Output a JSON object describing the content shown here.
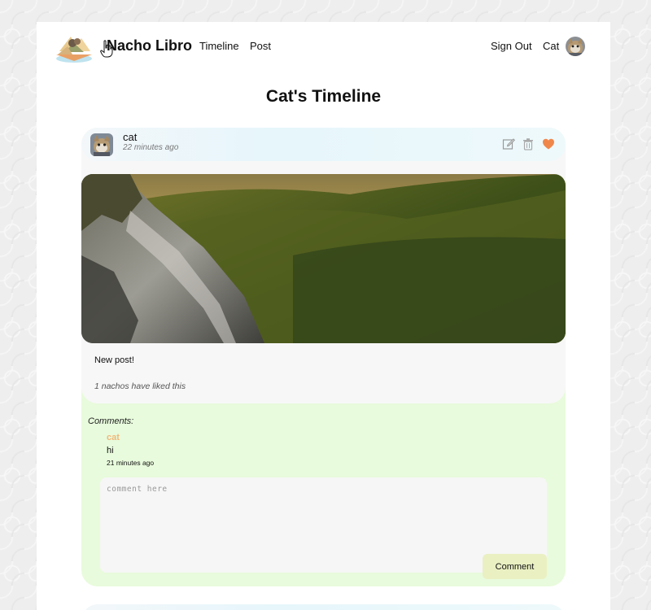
{
  "app": {
    "title": "Nacho Libro"
  },
  "nav": {
    "links": [
      {
        "label": "Timeline"
      },
      {
        "label": "Post"
      }
    ],
    "sign_out": "Sign Out",
    "user_name": "Cat"
  },
  "page": {
    "title": "Cat's Timeline"
  },
  "post": {
    "user": "cat",
    "time": "22 minutes ago",
    "text": "New post!",
    "likes": "1 nachos have liked this",
    "liked": true,
    "actions": [
      "edit-icon",
      "trash-icon",
      "heart-icon"
    ]
  },
  "comments": {
    "label": "Comments:",
    "items": [
      {
        "author": "cat",
        "text": "hi",
        "time": "21 minutes ago"
      }
    ],
    "input_placeholder": "comment here",
    "button_label": "Comment"
  },
  "colors": {
    "heart": "#f0874a",
    "comment_author": "#f0b87a",
    "comment_area": "#e8fbdc",
    "comment_button": "#eaf0c2"
  }
}
